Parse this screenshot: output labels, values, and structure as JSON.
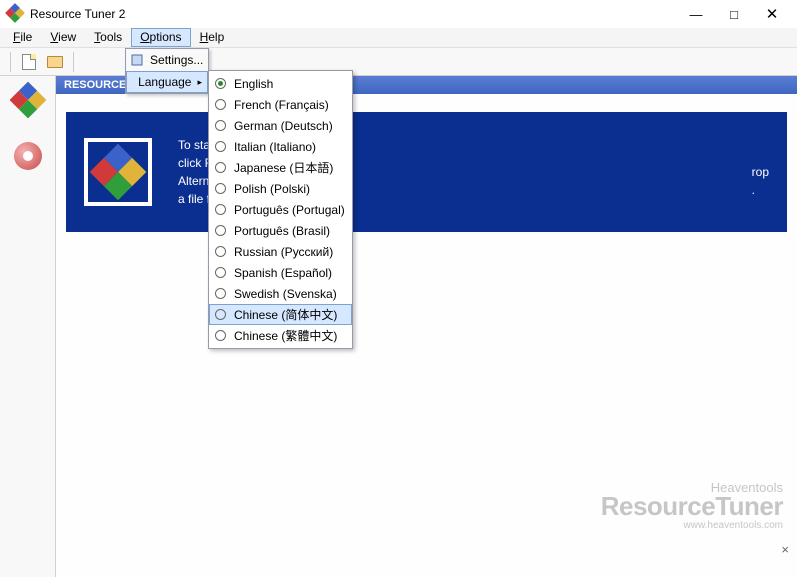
{
  "window": {
    "title": "Resource Tuner 2"
  },
  "menu": {
    "file": "File",
    "view": "View",
    "tools": "Tools",
    "options": "Options",
    "help": "Help"
  },
  "toolbar": {
    "help_glyph": "?"
  },
  "header": {
    "label": "RESOURCE"
  },
  "welcome": {
    "line1": "To start",
    "line2": "click F",
    "line3": "Alterna",
    "line4": "a file f",
    "partial_right1": "rop",
    "partial_right2": "."
  },
  "options_menu": {
    "settings": "Settings...",
    "language": "Language",
    "arrow": "▸"
  },
  "languages": [
    {
      "label": "English",
      "selected": true,
      "highlight": false
    },
    {
      "label": "French (Français)",
      "selected": false,
      "highlight": false
    },
    {
      "label": "German (Deutsch)",
      "selected": false,
      "highlight": false
    },
    {
      "label": "Italian (Italiano)",
      "selected": false,
      "highlight": false
    },
    {
      "label": "Japanese (日本語)",
      "selected": false,
      "highlight": false
    },
    {
      "label": "Polish (Polski)",
      "selected": false,
      "highlight": false
    },
    {
      "label": "Português (Portugal)",
      "selected": false,
      "highlight": false
    },
    {
      "label": "Português (Brasil)",
      "selected": false,
      "highlight": false
    },
    {
      "label": "Russian (Русский)",
      "selected": false,
      "highlight": false
    },
    {
      "label": "Spanish (Español)",
      "selected": false,
      "highlight": false
    },
    {
      "label": "Swedish (Svenska)",
      "selected": false,
      "highlight": false
    },
    {
      "label": "Chinese (简体中文)",
      "selected": false,
      "highlight": true
    },
    {
      "label": "Chinese (繁體中文)",
      "selected": false,
      "highlight": false
    }
  ],
  "watermark": {
    "brand1": "Heaventools",
    "brand2": "ResourceTuner",
    "url": "www.heaventools.com"
  },
  "closebar": "×"
}
